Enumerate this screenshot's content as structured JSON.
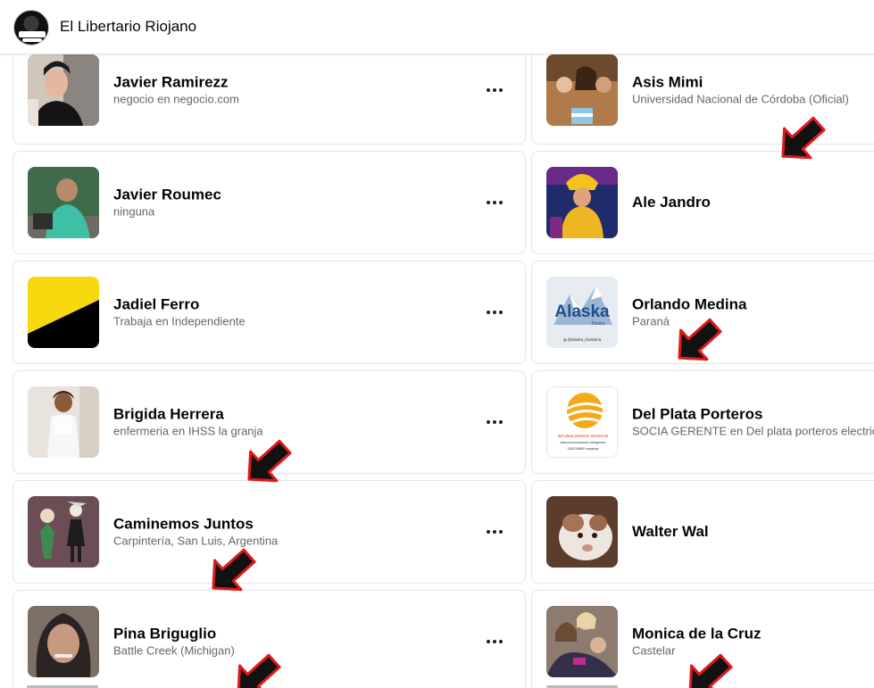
{
  "header": {
    "page_name": "El Libertario Riojano",
    "avatar_caption": "EL LIBERTARIO RIOJANO"
  },
  "members_left": [
    {
      "name": "Javier Ramirezz",
      "detail": "negocio en negocio.com"
    },
    {
      "name": "Javier Roumec",
      "detail": "ninguna"
    },
    {
      "name": "Jadiel Ferro",
      "detail": "Trabaja en Independiente"
    },
    {
      "name": "Brigida Herrera",
      "detail": "enfermeria en IHSS la granja"
    },
    {
      "name": "Caminemos Juntos",
      "detail": "Carpintería, San Luis, Argentina"
    },
    {
      "name": "Pina Briguglio",
      "detail": "Battle Creek (Michigan)"
    }
  ],
  "members_right": [
    {
      "name": "Asis Mimi",
      "detail": "Universidad Nacional de Córdoba (Oficial)"
    },
    {
      "name": "Ale Jandro",
      "detail": ""
    },
    {
      "name": "Orlando Medina",
      "detail": "Paraná"
    },
    {
      "name": "Del Plata Porteros",
      "detail": "SOCIA GERENTE en Del plata porteros electricos"
    },
    {
      "name": "Walter Wal",
      "detail": ""
    },
    {
      "name": "Monica de la Cruz",
      "detail": "Castelar"
    }
  ],
  "thumbnails": {
    "alaska_logo": "Alaska",
    "alaska_sub": "Kiosko",
    "alaska_handle": "ig:@alaska_kioskpna",
    "delplata_line1": "del plata porteros electricos",
    "delplata_line2": "telecomunicaciones inteligentes",
    "delplata_line3": "1155749660 wapshop"
  },
  "colors": {
    "arrow": "#111111",
    "arrow_outline": "#e0191b",
    "card_border": "#e4e6eb",
    "subtext": "#65676b"
  },
  "icons": {
    "more": "more-options-icon",
    "annotation": "red-outlined-arrow"
  }
}
